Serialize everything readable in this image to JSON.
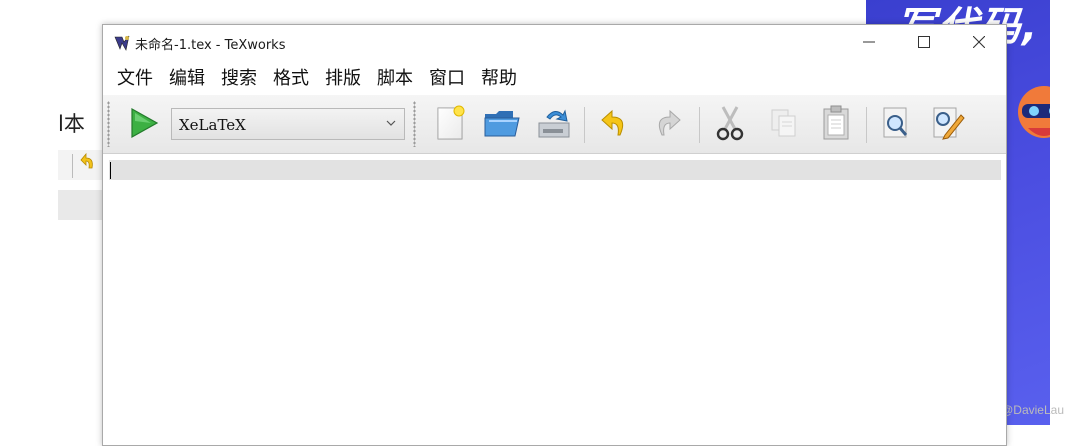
{
  "background": {
    "window_menu_fragment": "l本",
    "banner_text": "写代码,"
  },
  "window": {
    "title": "未命名-1.tex - TeXworks",
    "controls": {
      "minimize": "—",
      "maximize": "☐",
      "close": "✕"
    }
  },
  "menubar": {
    "items": [
      "文件",
      "编辑",
      "搜索",
      "格式",
      "排版",
      "脚本",
      "窗口",
      "帮助"
    ]
  },
  "toolbar": {
    "typeset_engine": "XeLaTeX",
    "icons": [
      "typeset-run-icon",
      "new-file-icon",
      "open-folder-icon",
      "save-icon",
      "undo-icon",
      "redo-icon",
      "cut-icon",
      "copy-icon",
      "paste-icon",
      "find-icon",
      "replace-icon"
    ]
  },
  "editor": {
    "content": ""
  },
  "watermark": "CSDN @DavieLau",
  "colors": {
    "run_green": "#3cb043",
    "banner_blue": "#4a4de0",
    "current_line": "#e2e2e2"
  }
}
